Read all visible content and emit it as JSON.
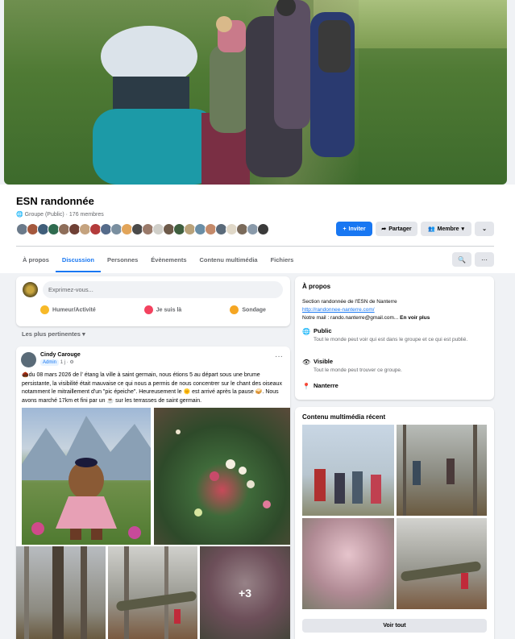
{
  "group": {
    "name": "ESN randonnée",
    "meta": "Groupe (Public) · 176 membres",
    "avatar_colors": [
      "#6b7a8a",
      "#a4583d",
      "#405e7a",
      "#2f6b4f",
      "#8e6e5a",
      "#6f4035",
      "#c5a37f",
      "#b33b3b",
      "#556b8a",
      "#7a8fa0",
      "#e2a55a",
      "#4a4a4a",
      "#9a7a6a",
      "#d0cfc9",
      "#6d5a4a",
      "#3f5f3f",
      "#b9a27a",
      "#6a8ea6",
      "#c48a6a",
      "#5a6a7a",
      "#e0d8c8",
      "#7a6a5a",
      "#8a9aaa",
      "#3a3a3a"
    ]
  },
  "actions": {
    "invite": "Inviter",
    "share": "Partager",
    "member": "Membre",
    "more": "⌄"
  },
  "tabs": [
    "À propos",
    "Discussion",
    "Personnes",
    "Évènements",
    "Contenu multimédia",
    "Fichiers"
  ],
  "composer": {
    "placeholder": "Exprimez-vous...",
    "mood": "Humeur/Activité",
    "checkin": "Je suis là",
    "poll": "Sondage"
  },
  "sort_label": "Les plus pertinentes ▾",
  "post": {
    "author": "Cindy Carouge",
    "badge": "Admin",
    "time": "1 j · ⚙",
    "more": "···",
    "text": "🌰du 08 mars 2026 de l' étang la ville à saint germain, nous étions 5 au départ sous une brume persistante, la visibilité était mauvaise ce qui nous a permis de nous concentrer sur le chant des oiseaux notamment le mitraillement d'un \"pic épeiche\". Heureusement le 🌞 est arrivé après la pause 🥪. Nous avons marché 17km et fini par un ☕ sur les terrasses de saint germain.",
    "more_photos": "+3"
  },
  "about": {
    "title": "À propos",
    "desc": "Section randonnée de l'ESN de Nanterre",
    "link": "http://randonnee-nanterre.com/",
    "mail_prefix": "Notre mail : rando.nanterre@gmail.com... ",
    "see_more": "En voir plus",
    "public_title": "Public",
    "public_sub": "Tout le monde peut voir qui est dans le groupe et ce qui est publié.",
    "visible_title": "Visible",
    "visible_sub": "Tout le monde peut trouver ce groupe.",
    "location": "Nanterre"
  },
  "media": {
    "title": "Contenu multimédia récent",
    "see_all": "Voir tout"
  }
}
